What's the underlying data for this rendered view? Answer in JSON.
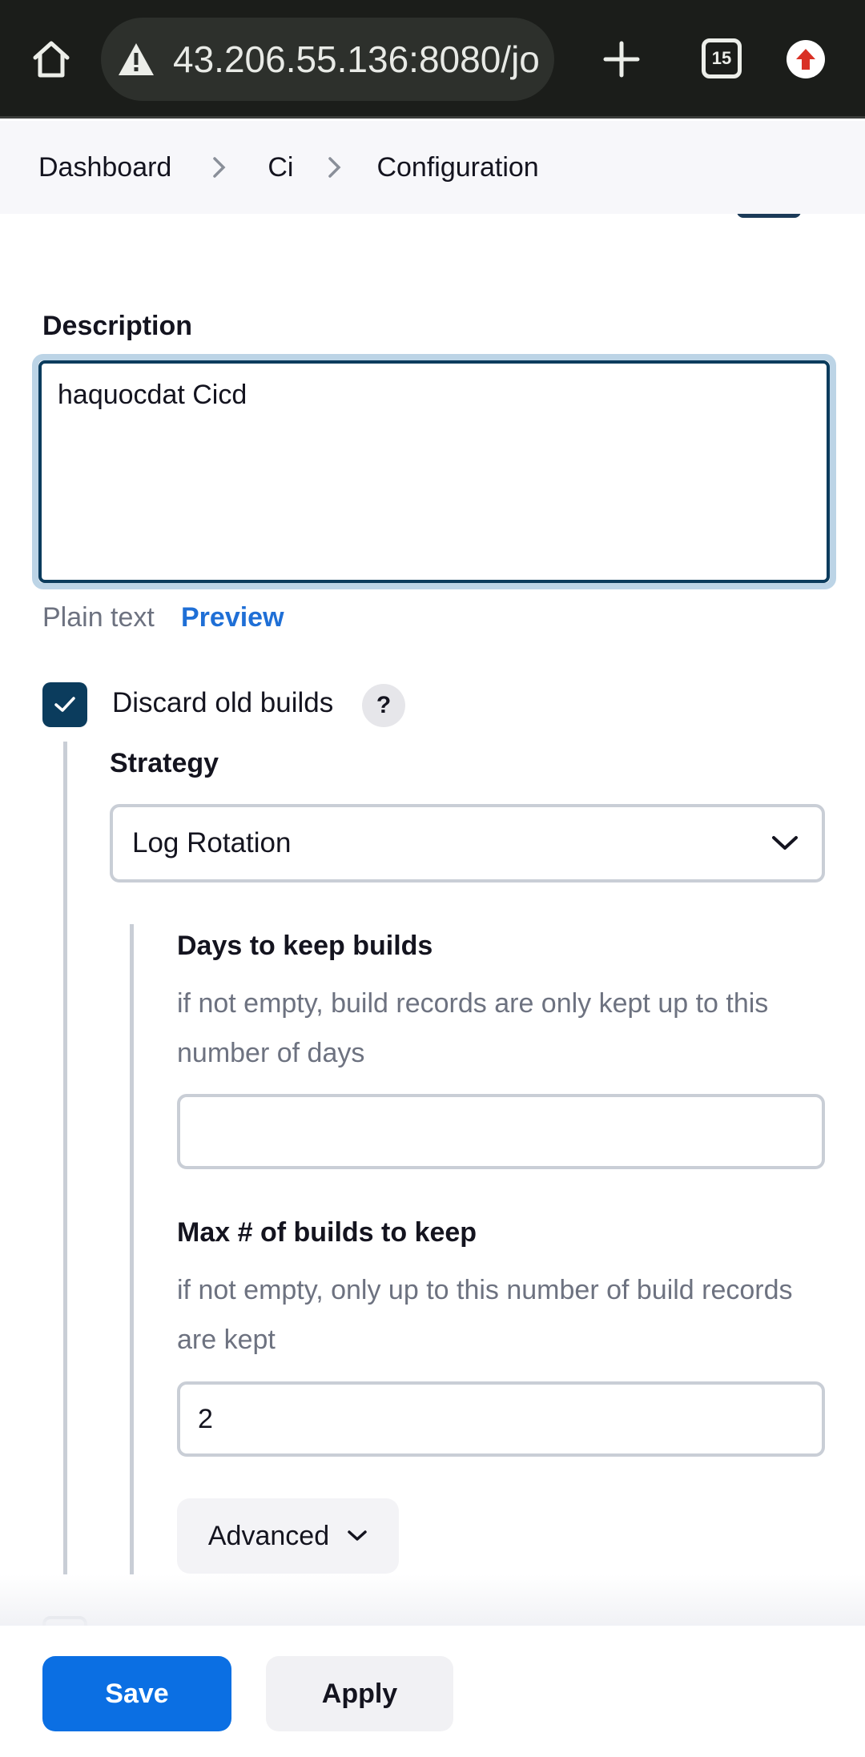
{
  "browser": {
    "url": "43.206.55.136:8080/jo",
    "tab_count": "15"
  },
  "breadcrumb": {
    "items": [
      "Dashboard",
      "Ci",
      "Configuration"
    ]
  },
  "form": {
    "description_label": "Description",
    "description_value": "haquocdat Cicd",
    "plain_text_label": "Plain text",
    "preview_label": "Preview",
    "discard_label": "Discard old builds",
    "discard_checked": true,
    "help_symbol": "?",
    "strategy_label": "Strategy",
    "strategy_value": "Log Rotation",
    "days_label": "Days to keep builds",
    "days_help": "if not empty, build records are only kept up to this number of days",
    "days_value": "",
    "max_label": "Max # of builds to keep",
    "max_help": "if not empty, only up to this number of build records are kept",
    "max_value": "2",
    "advanced_label": "Advanced"
  },
  "actions": {
    "save_label": "Save",
    "apply_label": "Apply"
  },
  "colors": {
    "primary": "#0b6fe3",
    "checkbox": "#0b3c5d",
    "link": "#1f6fd6",
    "browser_bg": "#1b1d1a"
  }
}
